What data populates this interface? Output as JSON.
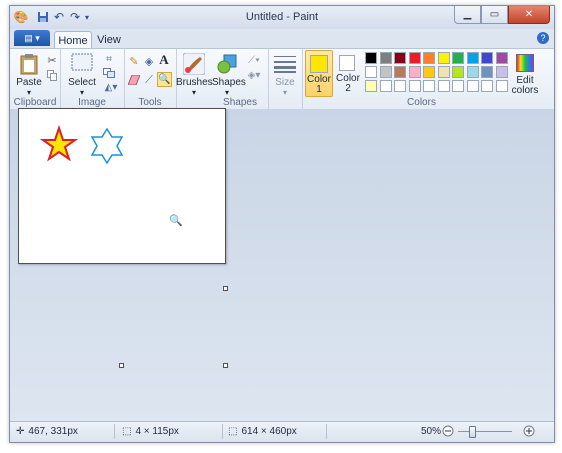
{
  "title": "Untitled - Paint",
  "tabs": [
    "Home",
    "View"
  ],
  "ribbon": {
    "groups": {
      "clipboard": "Clipboard",
      "image": "Image",
      "tools": "Tools",
      "shapes": "Shapes",
      "colors": "Colors"
    },
    "buttons": {
      "paste": "Paste",
      "select": "Select",
      "brushes": "Brushes",
      "shapes": "Shapes",
      "size": "Size",
      "color1": "Color\n1",
      "color2": "Color\n2",
      "edit_colors": "Edit\ncolors"
    },
    "color1_value": "#FFE600",
    "color2_value": "#FFFFFF",
    "palette_row1": [
      "#000000",
      "#7f7f7f",
      "#880015",
      "#ed1c24",
      "#ff7f27",
      "#fff200",
      "#22b14c",
      "#00a2e8",
      "#3f48cc",
      "#a349a4"
    ],
    "palette_row2": [
      "#ffffff",
      "#c3c3c3",
      "#b97a57",
      "#ffaec9",
      "#ffc90e",
      "#efe4b0",
      "#b5e61d",
      "#99d9ea",
      "#7092be",
      "#c8bfe7"
    ],
    "palette_row3": [
      "#ffffb0",
      "#ffffff",
      "#ffffff",
      "#ffffff",
      "#ffffff",
      "#ffffff",
      "#ffffff",
      "#ffffff",
      "#ffffff",
      "#ffffff"
    ]
  },
  "canvas_shapes": {
    "red_star_fill": "#FFE600",
    "red_star_stroke": "#E02020",
    "blue_star_stroke": "#1E90D8"
  },
  "status": {
    "cursor_pos": "467, 331px",
    "selection_size": "4 × 115px",
    "image_size": "614 × 460px",
    "zoom": "50%"
  }
}
